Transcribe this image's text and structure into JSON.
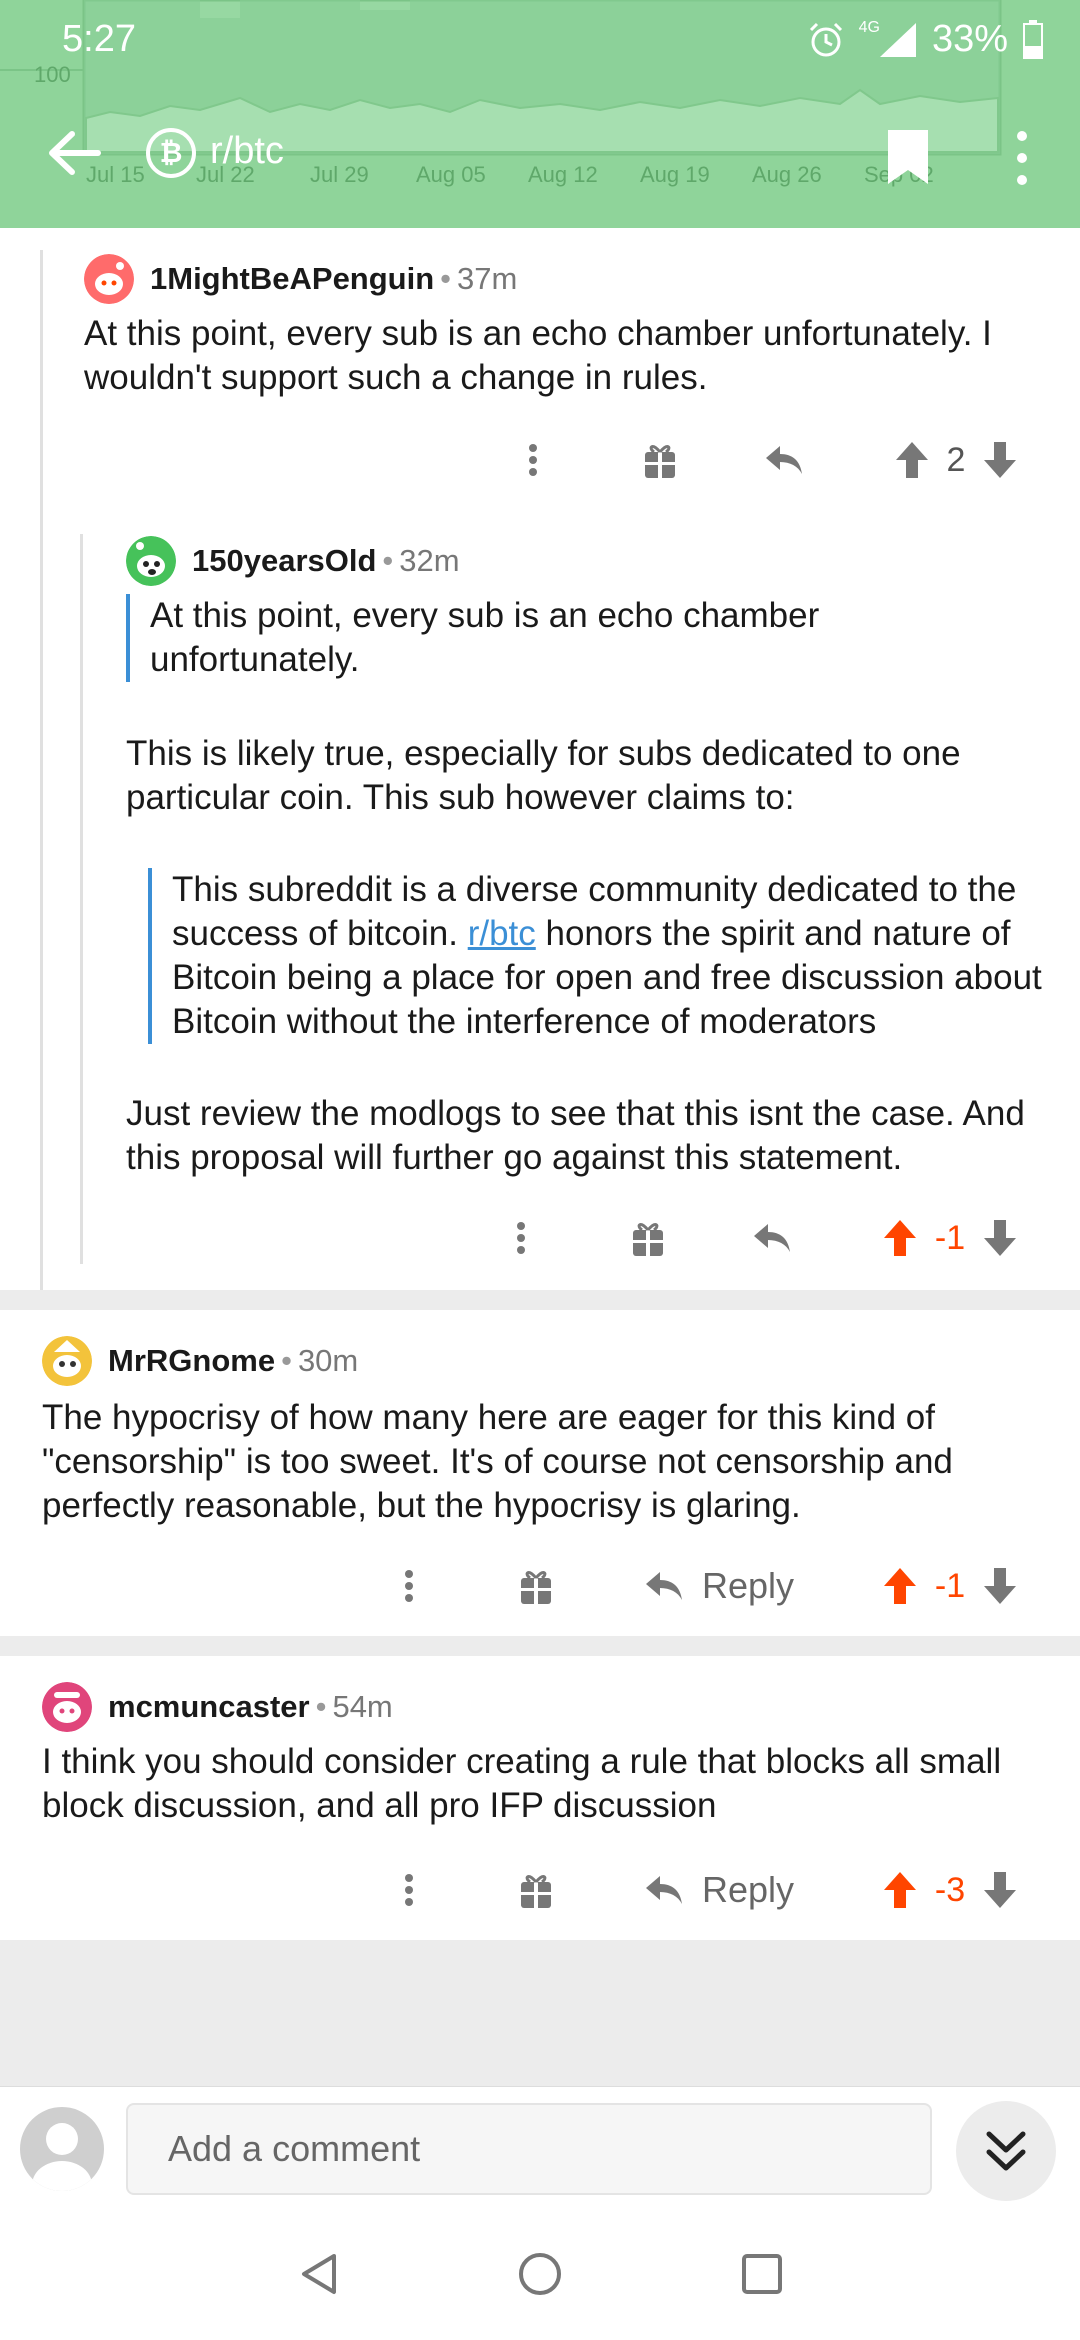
{
  "status_bar": {
    "time": "5:27",
    "network": "4G",
    "battery": "33%"
  },
  "header": {
    "subreddit": "r/btc",
    "background_chart": {
      "y_labels": [
        "100"
      ],
      "x_labels": [
        "Jul 15",
        "Jul 22",
        "Jul 29",
        "Aug 05",
        "Aug 12",
        "Aug 19",
        "Aug 26",
        "Sep 02"
      ]
    }
  },
  "comments": [
    {
      "author": "1MightBeAPenguin",
      "age": "37m",
      "body": "At this point, every sub is an echo chamber unfortunately. I wouldn't support such a change in rules.",
      "score": "2"
    },
    {
      "author": "150yearsOld",
      "age": "32m",
      "quote1": "At this point, every sub is an echo chamber unfortunately.",
      "para1": "This is likely true, especially for subs dedicated to one particular coin. This sub however claims to:",
      "quote2_before": "This subreddit is a diverse community dedicated to the success of bitcoin. ",
      "quote2_link": "r/btc",
      "quote2_after": " honors the spirit and nature of Bitcoin being a place for open and free discussion about Bitcoin without the interference of moderators",
      "para2": "Just review the modlogs to see that this isnt the case. And this proposal will further go against this statement.",
      "score": "-1"
    },
    {
      "author": "MrRGnome",
      "age": "30m",
      "body": "The hypocrisy of how many here are eager for this kind of \"censorship\" is too sweet. It's of course not censorship and perfectly reasonable, but the hypocrisy is glaring.",
      "reply_label": "Reply",
      "score": "-1"
    },
    {
      "author": "mcmuncaster",
      "age": "54m",
      "body": "I think you should consider creating a rule that blocks all small block discussion, and all pro IFP discussion",
      "reply_label": "Reply",
      "score": "-3"
    }
  ],
  "compose": {
    "placeholder": "Add a comment"
  },
  "colors": {
    "header_bg": "#8fd49a",
    "downvoted": "#ff4500",
    "link": "#3b8fd6",
    "quote_bar": "#3b8fd6"
  },
  "icons": [
    "back-arrow-icon",
    "bitcoin-icon",
    "bookmark-icon",
    "more-vert-icon",
    "award-icon",
    "reply-icon",
    "upvote-icon",
    "downvote-icon",
    "double-chevron-down-icon",
    "alarm-icon",
    "signal-icon",
    "battery-icon"
  ]
}
